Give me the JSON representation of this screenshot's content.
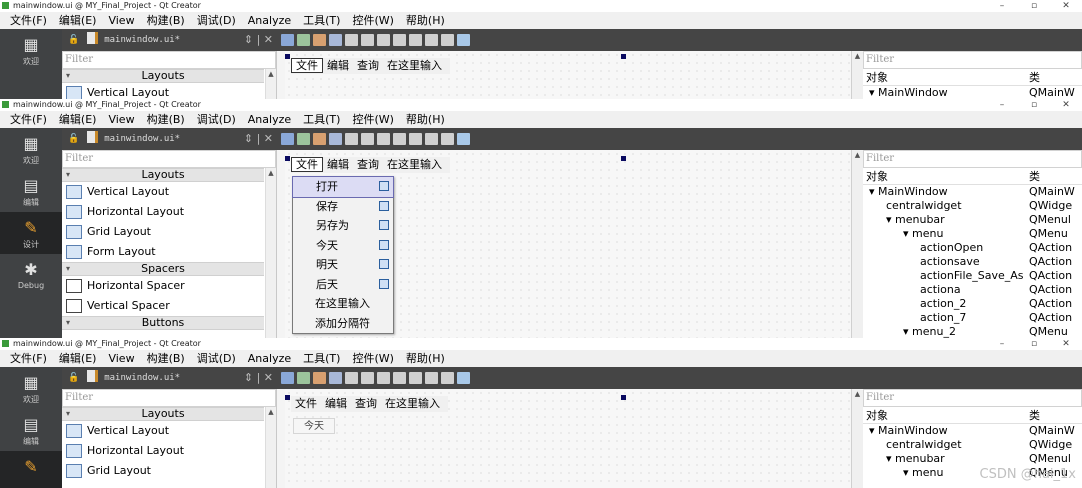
{
  "window_title": "mainwindow.ui @ MY_Final_Project - Qt Creator",
  "window_controls": [
    "–",
    "▫",
    "✕"
  ],
  "menubar": [
    "文件(F)",
    "编辑(E)",
    "View",
    "构建(B)",
    "调试(D)",
    "Analyze",
    "工具(T)",
    "控件(W)",
    "帮助(H)"
  ],
  "modes": [
    {
      "label": "欢迎",
      "icon": "grid-icon"
    },
    {
      "label": "编辑",
      "icon": "edit-icon"
    },
    {
      "label": "设计",
      "icon": "design-icon"
    },
    {
      "label": "Debug",
      "icon": "bug-icon"
    }
  ],
  "file_tab": {
    "name": "mainwindow.ui*",
    "controls": "⇕ | ✕"
  },
  "filter_placeholder": "Filter",
  "widget_box": {
    "layouts_header": "Layouts",
    "layouts": [
      "Vertical Layout",
      "Horizontal Layout",
      "Grid Layout",
      "Form Layout"
    ],
    "spacers_header": "Spacers",
    "spacers": [
      "Horizontal Spacer",
      "Vertical Spacer"
    ],
    "buttons_header": "Buttons"
  },
  "form_menubar": [
    "文件",
    "编辑",
    "查询",
    "在这里输入"
  ],
  "file_menu": [
    "打开",
    "保存",
    "另存为",
    "今天",
    "明天",
    "后天",
    "在这里输入",
    "添加分隔符"
  ],
  "submenu_item": "今天",
  "object_inspector": {
    "col_object": "对象",
    "col_class": "类",
    "rows": [
      {
        "name": "▾ MainWindow",
        "cls": "QMainW",
        "indent": 0
      },
      {
        "name": "centralwidget",
        "cls": "QWidge",
        "indent": 1
      },
      {
        "name": "▾ menubar",
        "cls": "QMenul",
        "indent": 1
      },
      {
        "name": "▾ menu",
        "cls": "QMenu",
        "indent": 2
      },
      {
        "name": "actionOpen",
        "cls": "QAction",
        "indent": 3
      },
      {
        "name": "actionsave",
        "cls": "QAction",
        "indent": 3
      },
      {
        "name": "actionFile_Save_As",
        "cls": "QAction",
        "indent": 3
      },
      {
        "name": "actiona",
        "cls": "QAction",
        "indent": 3
      },
      {
        "name": "action_2",
        "cls": "QAction",
        "indent": 3
      },
      {
        "name": "action_7",
        "cls": "QAction",
        "indent": 3
      },
      {
        "name": "▾ menu_2",
        "cls": "QMenu",
        "indent": 2
      }
    ],
    "top_row_truncated": "▾ MainWindow"
  },
  "watermark": "CSDN @hai_1x",
  "colors": {
    "toolbar_bg": "#454545",
    "modebar_bg": "#404244",
    "accent": "#3a6ea5"
  }
}
